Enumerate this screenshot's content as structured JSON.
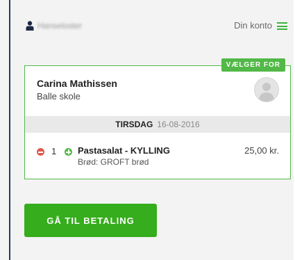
{
  "header": {
    "username": "Hanseloster",
    "account_label": "Din konto",
    "icons": {
      "user": "user-icon",
      "menu": "hamburger-menu-icon"
    }
  },
  "card": {
    "badge": "VÆLGER FOR",
    "student_name": "Carina Mathissen",
    "school": "Balle skole",
    "avatar_icon": "avatar-placeholder-icon",
    "day": {
      "name": "TIRSDAG",
      "date": "16-08-2016"
    },
    "items": [
      {
        "quantity": "1",
        "name": "Pastasalat - KYLLING",
        "option": "Brød: GROFT brød",
        "price": "25,00 kr."
      }
    ]
  },
  "checkout_button": "GÅ TIL BETALING",
  "colors": {
    "accent": "#52b847",
    "remove": "#e05a4e",
    "button": "#36ad1c"
  }
}
